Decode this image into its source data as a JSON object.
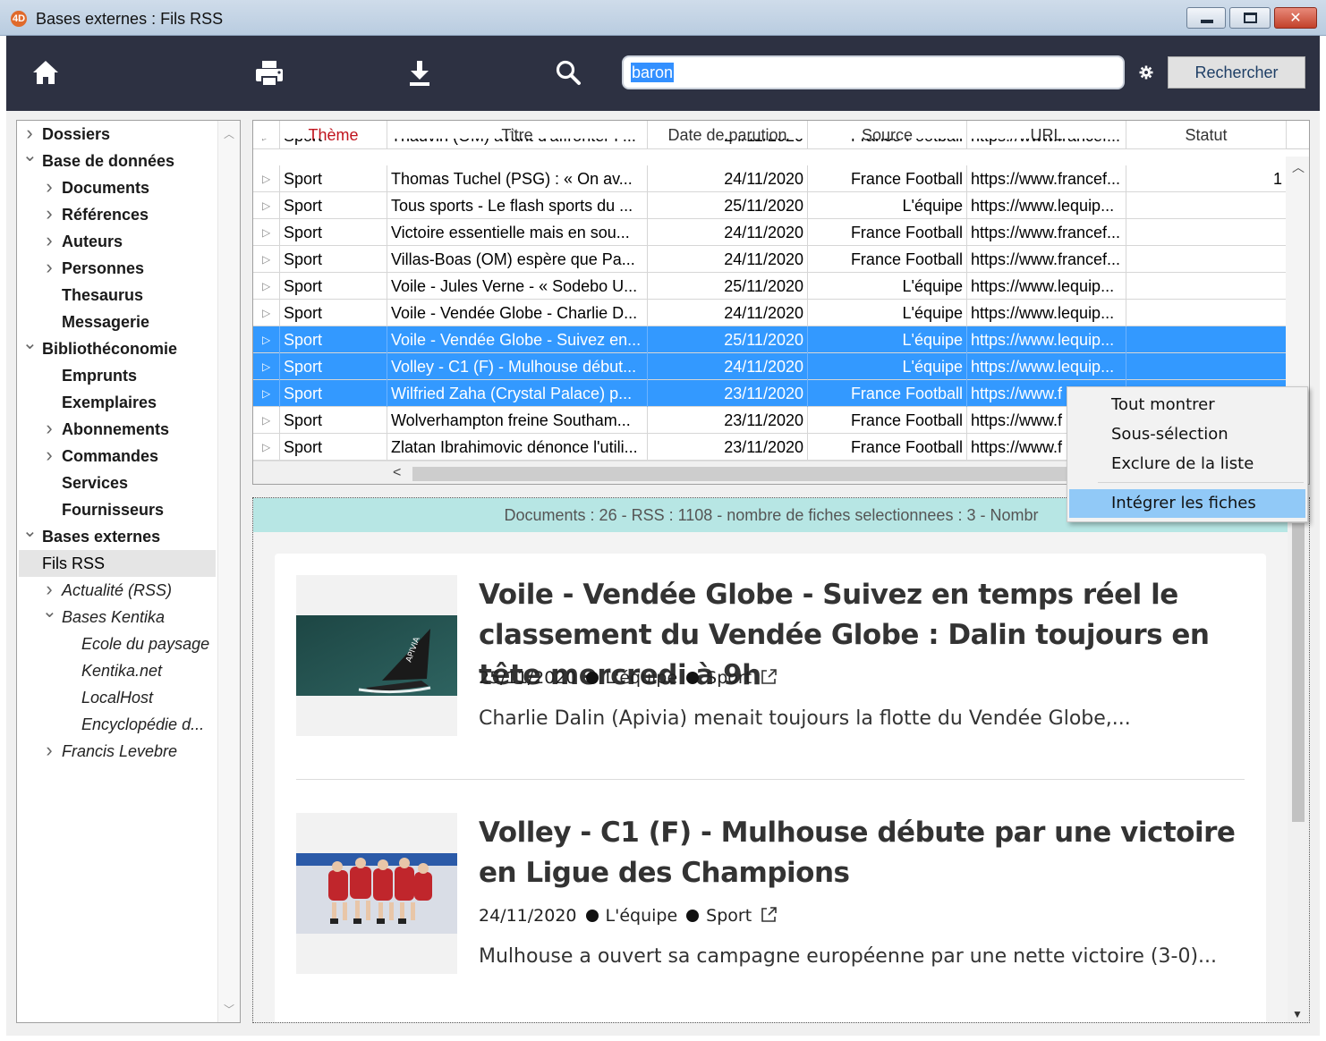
{
  "window": {
    "title": "Bases externes : Fils RSS",
    "app_icon_text": "4D"
  },
  "toolbar": {
    "search_value": "baron",
    "search_button": "Rechercher",
    "icons": [
      "home-icon",
      "print-icon",
      "download-icon",
      "search-icon",
      "gear-icon"
    ]
  },
  "sidebar": {
    "items": [
      {
        "label": "Dossiers",
        "chevron": ">",
        "style": "bold"
      },
      {
        "label": "Base de données",
        "chevron": "v",
        "style": "bold"
      },
      {
        "label": "Documents",
        "chevron": ">",
        "style": "bold"
      },
      {
        "label": "Références",
        "chevron": ">",
        "style": "bold"
      },
      {
        "label": "Auteurs",
        "chevron": ">",
        "style": "bold"
      },
      {
        "label": "Personnes",
        "chevron": ">",
        "style": "bold"
      },
      {
        "label": "Thesaurus",
        "chevron": "",
        "style": "bold"
      },
      {
        "label": "Messagerie",
        "chevron": "",
        "style": "bold"
      },
      {
        "label": "Bibliothéconomie",
        "chevron": "v",
        "style": "bold"
      },
      {
        "label": "Emprunts",
        "chevron": "",
        "style": "bold"
      },
      {
        "label": "Exemplaires",
        "chevron": "",
        "style": "bold"
      },
      {
        "label": "Abonnements",
        "chevron": ">",
        "style": "bold"
      },
      {
        "label": "Commandes",
        "chevron": ">",
        "style": "bold"
      },
      {
        "label": "Services",
        "chevron": "",
        "style": "bold"
      },
      {
        "label": "Fournisseurs",
        "chevron": "",
        "style": "bold"
      },
      {
        "label": "Bases externes",
        "chevron": "v",
        "style": "bold"
      },
      {
        "label": "Fils RSS",
        "chevron": "",
        "style": "normal",
        "selected": true
      },
      {
        "label": "Actualité (RSS)",
        "chevron": ">",
        "style": "italic"
      },
      {
        "label": "Bases Kentika",
        "chevron": "v",
        "style": "italic"
      },
      {
        "label": "Ecole du paysage",
        "chevron": "",
        "style": "italic"
      },
      {
        "label": "Kentika.net",
        "chevron": "",
        "style": "italic"
      },
      {
        "label": "LocalHost",
        "chevron": "",
        "style": "italic"
      },
      {
        "label": "Encyclopédie d...",
        "chevron": "",
        "style": "italic"
      },
      {
        "label": "Francis Levebre",
        "chevron": ">",
        "style": "italic"
      }
    ]
  },
  "table": {
    "columns": [
      "Thème",
      "Titre",
      "Date de parution",
      "Source",
      "URL",
      "Statut"
    ],
    "partial_row": [
      "Sport",
      "Thauvin (OM) avant d'affronter P...",
      "24/11/2020",
      "France Football",
      "https://www.francef..."
    ],
    "rows": [
      {
        "theme": "Sport",
        "titre": "Thomas Tuchel (PSG) : « On av...",
        "date": "24/11/2020",
        "source": "France Football",
        "url": "https://www.francef...",
        "statut": "1",
        "selected": false
      },
      {
        "theme": "Sport",
        "titre": "Tous sports - Le flash sports du ...",
        "date": "25/11/2020",
        "source": "L'équipe",
        "url": "https://www.lequip...",
        "statut": "",
        "selected": false
      },
      {
        "theme": "Sport",
        "titre": "Victoire essentielle mais en sou...",
        "date": "24/11/2020",
        "source": "France Football",
        "url": "https://www.francef...",
        "statut": "",
        "selected": false
      },
      {
        "theme": "Sport",
        "titre": "Villas-Boas (OM) espère que Pa...",
        "date": "24/11/2020",
        "source": "France Football",
        "url": "https://www.francef...",
        "statut": "",
        "selected": false
      },
      {
        "theme": "Sport",
        "titre": "Voile - Jules Verne - « Sodebo U...",
        "date": "25/11/2020",
        "source": "L'équipe",
        "url": "https://www.lequip...",
        "statut": "",
        "selected": false
      },
      {
        "theme": "Sport",
        "titre": "Voile - Vendée Globe - Charlie D...",
        "date": "24/11/2020",
        "source": "L'équipe",
        "url": "https://www.lequip...",
        "statut": "",
        "selected": false
      },
      {
        "theme": "Sport",
        "titre": "Voile - Vendée Globe - Suivez en...",
        "date": "25/11/2020",
        "source": "L'équipe",
        "url": "https://www.lequip...",
        "statut": "",
        "selected": true
      },
      {
        "theme": "Sport",
        "titre": "Volley - C1 (F) - Mulhouse début...",
        "date": "24/11/2020",
        "source": "L'équipe",
        "url": "https://www.lequip...",
        "statut": "",
        "selected": true
      },
      {
        "theme": "Sport",
        "titre": "Wilfried Zaha (Crystal Palace) p...",
        "date": "23/11/2020",
        "source": "France Football",
        "url": "https://www.f",
        "statut": "",
        "selected": true
      },
      {
        "theme": "Sport",
        "titre": "Wolverhampton freine Southam...",
        "date": "23/11/2020",
        "source": "France Football",
        "url": "https://www.f",
        "statut": "",
        "selected": false
      },
      {
        "theme": "Sport",
        "titre": "Zlatan Ibrahimovic dénonce l'utili...",
        "date": "23/11/2020",
        "source": "France Football",
        "url": "https://www.f",
        "statut": "",
        "selected": false
      }
    ]
  },
  "detail": {
    "status_text": "Documents : 26 - RSS : 1108 - nombre de fiches selectionnees : 3 - Nombr",
    "articles": [
      {
        "title": "Voile - Vendée Globe - Suivez en temps réel le classement du Vendée Globe : Dalin toujours en tête mercredi à 9h",
        "date": "25/11/2020",
        "source": "L'équipe",
        "theme": "Sport",
        "summary": "Charlie Dalin (Apivia) menait toujours la flotte du Vendée Globe,..."
      },
      {
        "title": "Volley - C1 (F) - Mulhouse débute par une victoire en Ligue des Champions",
        "date": "24/11/2020",
        "source": "L'équipe",
        "theme": "Sport",
        "summary": "Mulhouse a ouvert sa campagne européenne par une nette victoire (3-0)..."
      }
    ]
  },
  "context_menu": {
    "items": [
      "Tout montrer",
      "Sous-sélection",
      "Exclure de la liste",
      "Intégrer les fiches"
    ],
    "highlighted": "Intégrer les fiches"
  },
  "colors": {
    "toolbar_bg": "#2d3142",
    "selection": "#3399ff",
    "status_bar": "#b7e6e4",
    "menu_highlight": "#91c9f7",
    "header_accent": "#c0141e"
  }
}
